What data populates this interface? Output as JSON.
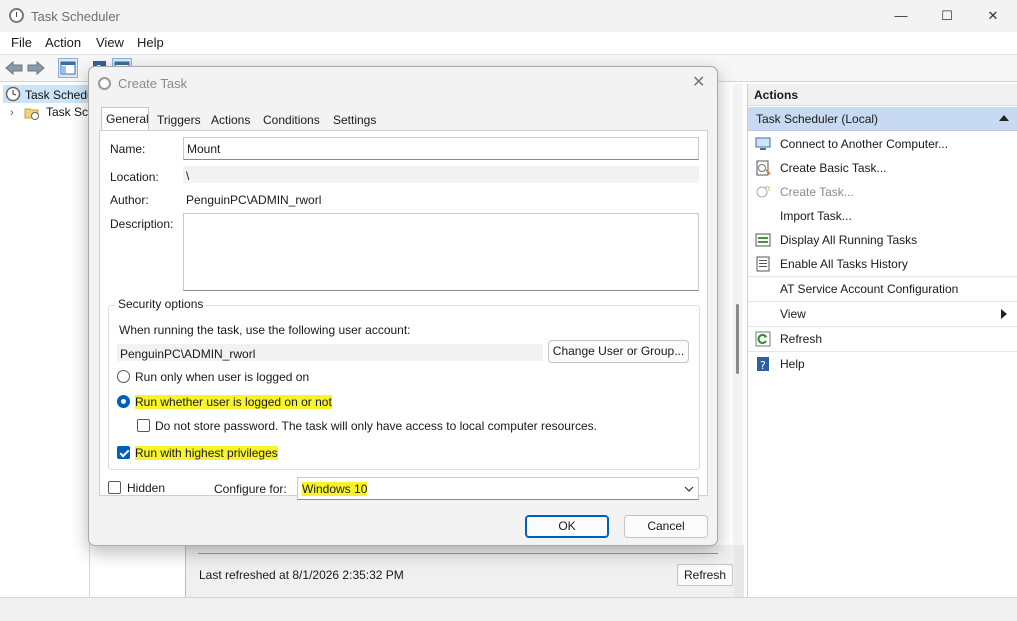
{
  "window": {
    "title": "Task Scheduler",
    "minimize": "—",
    "maximize": "☐",
    "close": "✕"
  },
  "menu": [
    "File",
    "Action",
    "View",
    "Help"
  ],
  "tree": {
    "root": "Task Scheduler (Local)",
    "child": "Task Scheduler Library"
  },
  "actions_panel": {
    "header": "Actions",
    "section": "Task Scheduler (Local)",
    "items": [
      {
        "label": "Connect to Another Computer...",
        "icon": "computer-icon",
        "enabled": true
      },
      {
        "label": "Create Basic Task...",
        "icon": "create-basic-task-icon",
        "enabled": true
      },
      {
        "label": "Create Task...",
        "icon": "create-task-icon",
        "enabled": false
      },
      {
        "label": "Import Task...",
        "icon": "",
        "enabled": true
      },
      {
        "label": "Display All Running Tasks",
        "icon": "running-tasks-icon",
        "enabled": true
      },
      {
        "label": "Enable All Tasks History",
        "icon": "history-icon",
        "enabled": true
      },
      {
        "label": "AT Service Account Configuration",
        "icon": "",
        "enabled": true
      },
      {
        "label": "View",
        "icon": "",
        "enabled": true
      },
      {
        "label": "Refresh",
        "icon": "refresh-icon",
        "enabled": true
      },
      {
        "label": "Help",
        "icon": "help-icon",
        "enabled": true
      }
    ]
  },
  "center": {
    "last_refreshed": "Last refreshed at 8/1/2026 2:35:32 PM",
    "refresh_button": "Refresh"
  },
  "dialog": {
    "title": "Create Task",
    "close": "✕",
    "tabs": [
      "General",
      "Triggers",
      "Actions",
      "Conditions",
      "Settings"
    ],
    "active_tab": "General",
    "name_label": "Name:",
    "name_value": "Mount",
    "location_label": "Location:",
    "location_value": "\\",
    "author_label": "Author:",
    "author_value": "PenguinPC\\ADMIN_rworl",
    "description_label": "Description:",
    "description_value": "",
    "security": {
      "title": "Security options",
      "account_prompt": "When running the task, use the following user account:",
      "account_value": "PenguinPC\\ADMIN_rworl",
      "change_button": "Change User or Group...",
      "radio_logged_on": "Run only when user is logged on",
      "radio_whether": "Run whether user is logged on or not",
      "selected_radio": "whether",
      "no_store_password": "Do not store password.  The task will only have access to local computer resources.",
      "no_store_password_checked": false,
      "highest_privileges": "Run with highest privileges",
      "highest_privileges_checked": true
    },
    "hidden_label": "Hidden",
    "hidden_checked": false,
    "configure_label": "Configure for:",
    "configure_value": "Windows 10",
    "ok": "OK",
    "cancel": "Cancel"
  },
  "colors": {
    "accent": "#005fb8",
    "highlight": "#f8f32b",
    "selection": "#c7daf1"
  }
}
